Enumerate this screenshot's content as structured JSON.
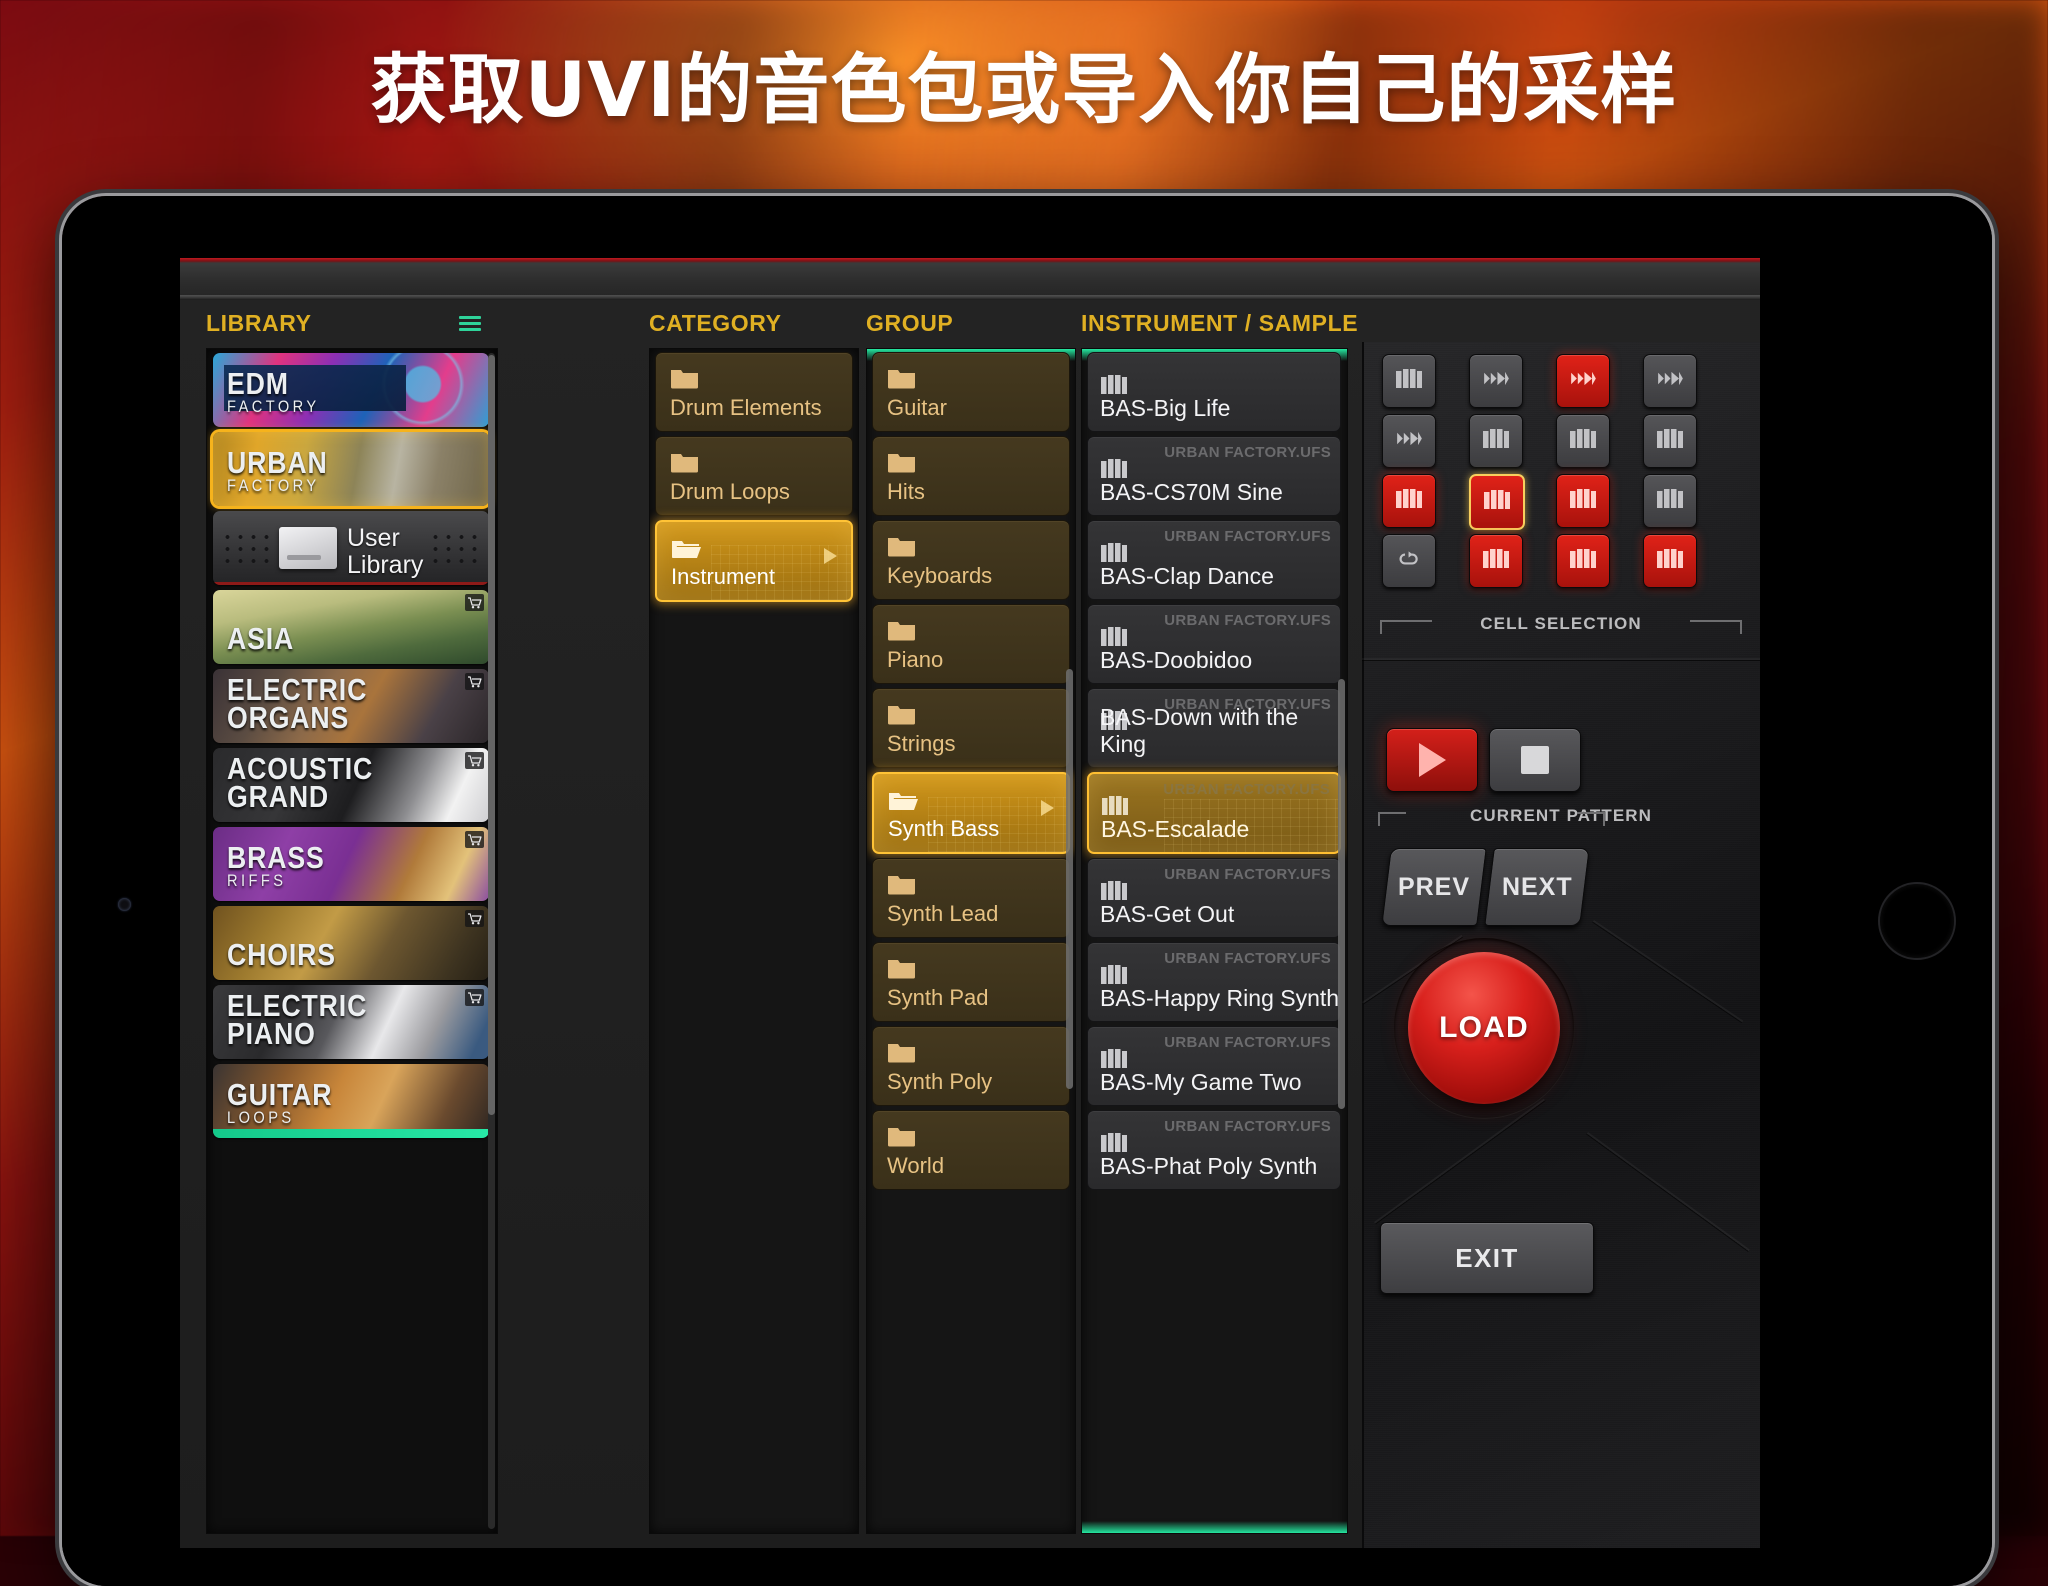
{
  "headline": "获取UVI的音色包或导入你自己的采样",
  "browser": {
    "columns": {
      "library": "LIBRARY",
      "category": "CATEGORY",
      "group": "GROUP",
      "instrument": "INSTRUMENT / SAMPLE"
    },
    "menu_icon": "hamburger-icon",
    "library_items": [
      {
        "title": "EDM",
        "subtitle": "FACTORY",
        "art": "art-edm",
        "selected": false,
        "cart": false
      },
      {
        "title": "URBAN",
        "subtitle": "FACTORY",
        "art": "art-urban",
        "selected": true,
        "cart": false
      },
      {
        "title": "User Library",
        "subtitle": "",
        "art": "art-user",
        "selected": false,
        "cart": false
      },
      {
        "title": "ASIA",
        "subtitle": "",
        "art": "art-asia",
        "selected": false,
        "cart": true
      },
      {
        "title": "ELECTRIC ORGANS",
        "subtitle": "",
        "art": "art-organs",
        "selected": false,
        "cart": true
      },
      {
        "title": "ACOUSTIC GRAND",
        "subtitle": "",
        "art": "art-grand",
        "selected": false,
        "cart": true
      },
      {
        "title": "BRASS",
        "subtitle": "RIFFS",
        "art": "art-brass",
        "selected": false,
        "cart": true
      },
      {
        "title": "CHOIRS",
        "subtitle": "",
        "art": "art-choirs",
        "selected": false,
        "cart": true
      },
      {
        "title": "ELECTRIC PIANO",
        "subtitle": "",
        "art": "art-epiano",
        "selected": false,
        "cart": true
      },
      {
        "title": "GUITAR",
        "subtitle": "LOOPS",
        "art": "art-guitar",
        "selected": false,
        "cart": false
      }
    ],
    "category_items": [
      {
        "label": "Drum Elements",
        "selected": false
      },
      {
        "label": "Drum Loops",
        "selected": false
      },
      {
        "label": "Instrument",
        "selected": true
      }
    ],
    "group_items": [
      {
        "label": "Guitar",
        "selected": false
      },
      {
        "label": "Hits",
        "selected": false
      },
      {
        "label": "Keyboards",
        "selected": false
      },
      {
        "label": "Piano",
        "selected": false
      },
      {
        "label": "Strings",
        "selected": false
      },
      {
        "label": "Synth Bass",
        "selected": true
      },
      {
        "label": "Synth Lead",
        "selected": false
      },
      {
        "label": "Synth Pad",
        "selected": false
      },
      {
        "label": "Synth Poly",
        "selected": false
      },
      {
        "label": "World",
        "selected": false
      }
    ],
    "instrument_items": [
      {
        "label": "BAS-Big Life",
        "source": "",
        "selected": false
      },
      {
        "label": "BAS-CS70M Sine",
        "source": "URBAN FACTORY.UFS",
        "selected": false
      },
      {
        "label": "BAS-Clap Dance",
        "source": "URBAN FACTORY.UFS",
        "selected": false
      },
      {
        "label": "BAS-Doobidoo",
        "source": "URBAN FACTORY.UFS",
        "selected": false
      },
      {
        "label": "BAS-Down with the King",
        "source": "URBAN FACTORY.UFS",
        "selected": false
      },
      {
        "label": "BAS-Escalade",
        "source": "URBAN FACTORY.UFS",
        "selected": true
      },
      {
        "label": "BAS-Get Out",
        "source": "URBAN FACTORY.UFS",
        "selected": false
      },
      {
        "label": "BAS-Happy Ring Synth",
        "source": "URBAN FACTORY.UFS",
        "selected": false
      },
      {
        "label": "BAS-My Game Two",
        "source": "URBAN FACTORY.UFS",
        "selected": false
      },
      {
        "label": "BAS-Phat Poly Synth",
        "source": "URBAN FACTORY.UFS",
        "selected": false
      }
    ]
  },
  "hardware": {
    "cell_selection_label": "CELL SELECTION",
    "current_pattern_label": "CURRENT PATTERN",
    "cells": [
      {
        "icon": "keys-icon",
        "state": "off",
        "highlighted": false
      },
      {
        "icon": "wave-icon",
        "state": "off",
        "highlighted": false
      },
      {
        "icon": "wave-icon",
        "state": "on",
        "highlighted": false
      },
      {
        "icon": "wave-icon",
        "state": "off",
        "highlighted": false
      },
      {
        "icon": "wave-icon",
        "state": "off",
        "highlighted": false
      },
      {
        "icon": "keys-icon",
        "state": "off",
        "highlighted": false
      },
      {
        "icon": "keys-icon",
        "state": "off",
        "highlighted": false
      },
      {
        "icon": "keys-icon",
        "state": "off",
        "highlighted": false
      },
      {
        "icon": "keys-icon",
        "state": "on",
        "highlighted": false
      },
      {
        "icon": "keys-icon",
        "state": "on",
        "highlighted": true
      },
      {
        "icon": "keys-icon",
        "state": "on",
        "highlighted": false
      },
      {
        "icon": "keys-icon",
        "state": "off",
        "highlighted": false
      },
      {
        "icon": "loop-icon",
        "state": "off",
        "highlighted": false
      },
      {
        "icon": "keys-icon",
        "state": "on",
        "highlighted": false
      },
      {
        "icon": "keys-icon",
        "state": "on",
        "highlighted": false
      },
      {
        "icon": "keys-icon",
        "state": "on",
        "highlighted": false
      }
    ],
    "play_icon": "play-icon",
    "stop_icon": "stop-icon",
    "prev_label": "PREV",
    "next_label": "NEXT",
    "load_label": "LOAD",
    "exit_label": "EXIT"
  },
  "colors": {
    "accent_gold": "#e0b023",
    "selection_gold": "#ffbf32",
    "teal": "#25e8a0",
    "red": "#d4201a"
  }
}
